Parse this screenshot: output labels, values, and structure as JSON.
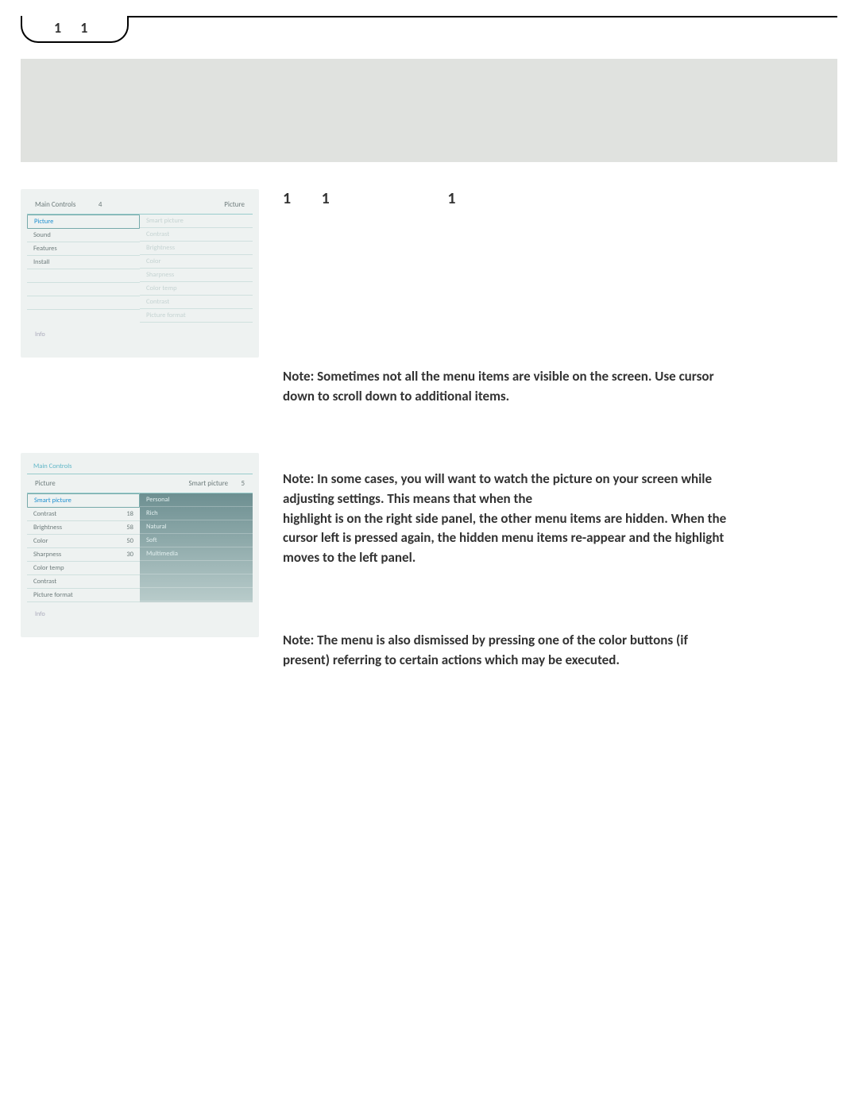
{
  "tab": {
    "n1": "1",
    "n2": "1"
  },
  "heading": {
    "a": "1",
    "b": "1",
    "c": "1"
  },
  "screenshot1": {
    "left_header": "Main Controls",
    "left_header_num": "4",
    "right_header": "Picture",
    "left_items": [
      "Picture",
      "Sound",
      "Features",
      "Install"
    ],
    "right_items": [
      "Smart picture",
      "Contrast",
      "Brightness",
      "Color",
      "Sharpness",
      "Color temp",
      "Contrast",
      "Picture format"
    ],
    "info": "Info"
  },
  "screenshot2": {
    "breadcrumb": "Main Controls",
    "left_header": "Picture",
    "right_header": "Smart picture",
    "right_header_num": "5",
    "left_items": [
      {
        "label": "Smart picture",
        "val": ""
      },
      {
        "label": "Contrast",
        "val": "18"
      },
      {
        "label": "Brightness",
        "val": "58"
      },
      {
        "label": "Color",
        "val": "50"
      },
      {
        "label": "Sharpness",
        "val": "30"
      },
      {
        "label": "Color temp",
        "val": ""
      },
      {
        "label": "Contrast",
        "val": ""
      },
      {
        "label": "Picture format",
        "val": ""
      }
    ],
    "right_items": [
      "Personal",
      "Rich",
      "Natural",
      "Soft",
      "Multimedia"
    ],
    "info": "Info"
  },
  "notes": {
    "n1": "Note: Sometimes not all the menu items are visible on the screen. Use cursor down to scroll down to additional items.",
    "n2a": "Note: In some cases, you will want to watch the picture on your screen while adjusting settings. This means that when the",
    "n2b": "highlight is on the right side panel, the other menu items are hidden. When the cursor left is pressed again, the hidden menu items re-appear and the highlight moves to the left panel.",
    "n3": "Note: The menu is also dismissed by pressing one of the color buttons (if present) referring to certain actions which may be executed."
  }
}
